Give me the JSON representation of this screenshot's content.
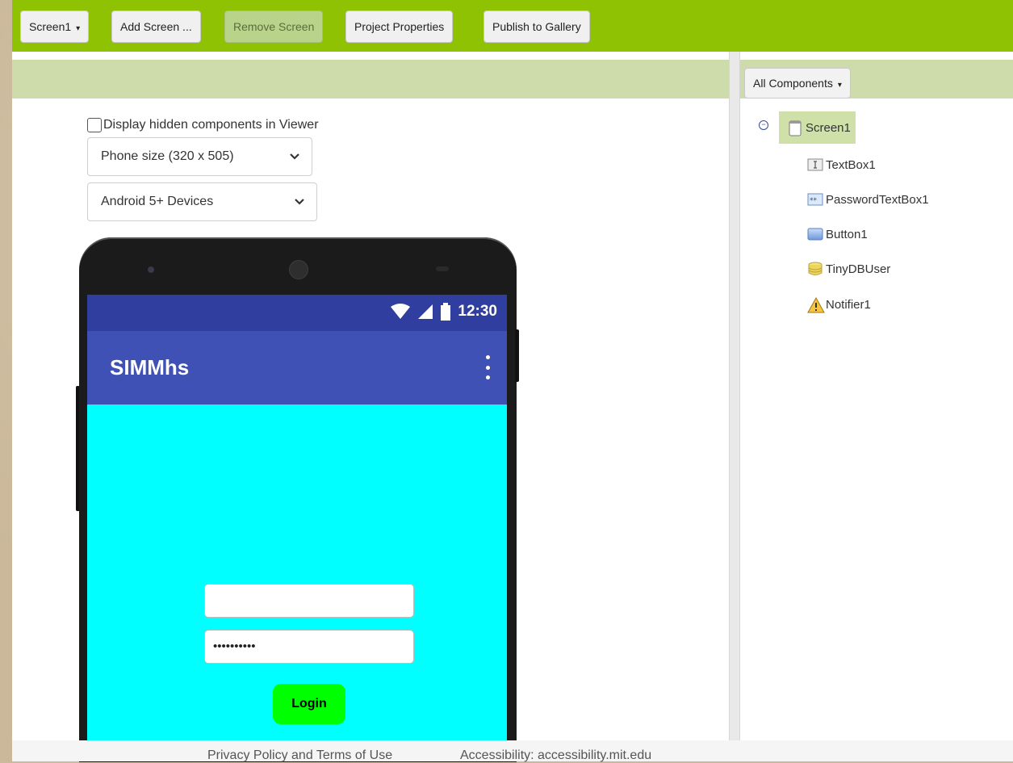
{
  "toolbar": {
    "screen_selector": "Screen1",
    "add_screen": "Add Screen ...",
    "remove_screen": "Remove Screen",
    "project_properties": "Project Properties",
    "publish_gallery": "Publish to Gallery"
  },
  "viewer": {
    "hidden_components_label": "Display hidden components in Viewer",
    "phone_size": "Phone size (320 x 505)",
    "device_type": "Android 5+ Devices"
  },
  "phone": {
    "time": "12:30",
    "app_title": "SIMMhs",
    "textbox_value": "",
    "password_value": "••••••••••",
    "login_label": "Login"
  },
  "components": {
    "filter": "All Components",
    "tree": [
      {
        "label": "Screen1",
        "icon": "screen-icon"
      },
      {
        "label": "TextBox1",
        "icon": "textbox-icon"
      },
      {
        "label": "PasswordTextBox1",
        "icon": "password-textbox-icon"
      },
      {
        "label": "Button1",
        "icon": "button-icon"
      },
      {
        "label": "TinyDBUser",
        "icon": "database-icon"
      },
      {
        "label": "Notifier1",
        "icon": "warning-icon"
      }
    ]
  },
  "footer": {
    "privacy": "Privacy Policy and Terms of Use",
    "accessibility": "Accessibility: accessibility.mit.edu"
  },
  "colors": {
    "toolbar": "#8fc202",
    "panel_header": "#cddcaa",
    "statusbar": "#303f9f",
    "appbar": "#3f51b5",
    "screen_bg": "#00ffff",
    "login_button": "#00ff00"
  }
}
